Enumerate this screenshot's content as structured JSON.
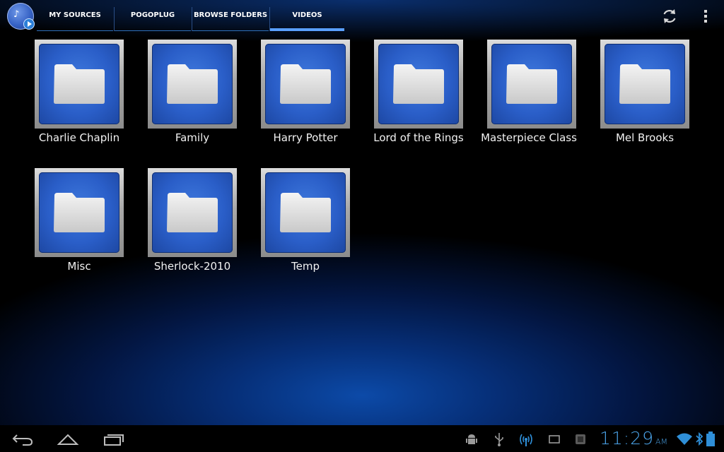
{
  "action_bar": {
    "app_icon": "media-app-icon",
    "tabs": [
      {
        "label": "MY SOURCES",
        "selected": false
      },
      {
        "label": "POGOPLUG",
        "selected": false
      },
      {
        "label": "BROWSE FOLDERS",
        "selected": false
      },
      {
        "label": "VIDEOS",
        "selected": true
      }
    ],
    "actions": [
      "refresh-icon",
      "overflow-menu-icon"
    ]
  },
  "folders": [
    {
      "label": "Charlie Chaplin"
    },
    {
      "label": "Family"
    },
    {
      "label": "Harry Potter"
    },
    {
      "label": "Lord of the Rings"
    },
    {
      "label": "Masterpiece Class"
    },
    {
      "label": "Mel Brooks"
    },
    {
      "label": "Misc"
    },
    {
      "label": "Sherlock-2010"
    },
    {
      "label": "Temp"
    }
  ],
  "system_bar": {
    "nav_buttons": [
      "back-icon",
      "home-icon",
      "recent-apps-icon"
    ],
    "status_icons": [
      "android-debug-icon",
      "usb-icon",
      "wireless-icon",
      "screenshot-icon",
      "storage-icon"
    ],
    "time": "11:29",
    "ampm": "AM",
    "connectivity": [
      "wifi-icon",
      "bluetooth-icon",
      "battery-icon"
    ]
  },
  "colors": {
    "accent": "#5aa0ff",
    "clock": "#4aa3e8",
    "tile_blue": "#2a5ec8"
  }
}
